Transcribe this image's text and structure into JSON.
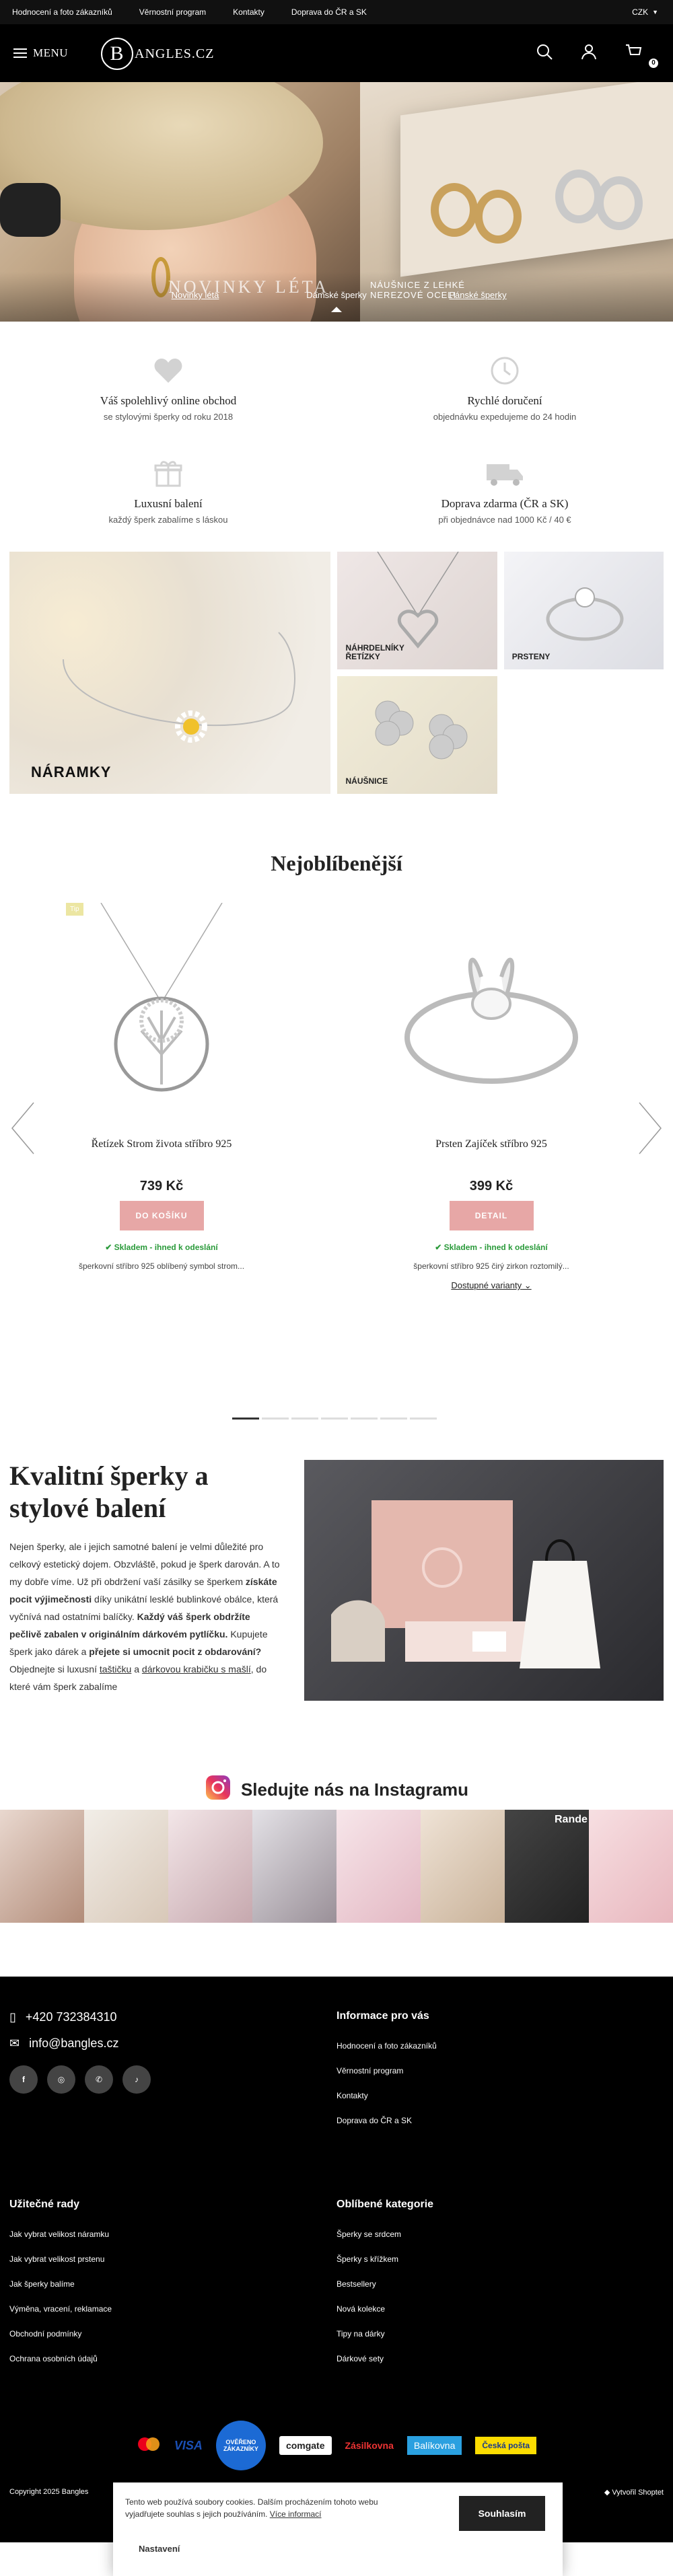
{
  "topbar": {
    "links": [
      "Hodnocení a foto zákazníků",
      "Věrnostní program",
      "Kontakty",
      "Doprava do ČR a SK"
    ],
    "currency": "CZK"
  },
  "header": {
    "menu_label": "MENU",
    "logo_letter": "B",
    "logo_text": "ANGLES.CZ",
    "cart_count": "0"
  },
  "hero": {
    "title": "NOVINKY LÉTA",
    "subtitle": "NÁUŠNICE Z LEHKÉ NEREZOVÉ OCELI",
    "tabs": [
      "Novinky léta",
      "Dámské šperky",
      "Pánské šperky"
    ]
  },
  "usp": [
    {
      "title": "Váš spolehlivý online obchod",
      "desc": "se stylovými šperky od roku 2018",
      "icon": "heart-icon"
    },
    {
      "title": "Rychlé doručení",
      "desc": "objednávku expedujeme do 24 hodin",
      "icon": "clock-icon"
    },
    {
      "title": "Luxusní balení",
      "desc": "každý šperk zabalíme s láskou",
      "icon": "gift-icon"
    },
    {
      "title": "Doprava zdarma (ČR a SK)",
      "desc": "při objednávce nad 1000 Kč / 40 €",
      "icon": "truck-icon"
    }
  ],
  "categories": [
    "NÁRAMKY",
    "NÁHRDELNÍKY ŘETÍZKY",
    "PRSTENY",
    "NÁUŠNICE"
  ],
  "popular": {
    "title": "Nejoblíbenější",
    "products": [
      {
        "badge": "Tip",
        "name": "Řetízek Strom života stříbro 925",
        "price": "739 Kč",
        "button": "DO KOŠÍKU",
        "stock": "Skladem - ihned k odeslání",
        "desc": "šperkovní stříbro 925 oblíbený symbol strom..."
      },
      {
        "name": "Prsten Zajíček stříbro 925",
        "price": "399 Kč",
        "button": "DETAIL",
        "stock": "Skladem - ihned k odeslání",
        "desc": "šperkovní stříbro 925 čirý zirkon roztomilý...",
        "variants": "Dostupné varianty"
      }
    ]
  },
  "packaging": {
    "title": "Kvalitní šperky a stylové balení",
    "p1": "Nejen šperky, ale i jejich samotné balení je velmi důležité pro celkový estetický dojem. Obzvláště, pokud je šperk darován. A to my dobře víme. Už při obdržení vaší zásilky se šperkem ",
    "b1": "získáte pocit výjimečnosti",
    "p2": " díky unikátní lesklé bublinkové obálce, která vyčnívá nad ostatními balíčky. ",
    "b2": "Každý váš šperk obdržíte pečlivě zabalen v originálním dárkovém pytlíčku.",
    "p3": " Kupujete šperk jako dárek a ",
    "b3": "přejete si umocnit pocit z obdarování?",
    "p4": " Objednejte si luxusní ",
    "l1": "taštičku",
    "p5": " a ",
    "l2": "dárkovou krabičku s mašlí",
    "p6": ", do které vám šperk zabalíme"
  },
  "instagram": {
    "title": "Sledujte nás na Instagramu",
    "tile_text_1": "Rande"
  },
  "footer": {
    "phone": "+420 732384310",
    "email": "info@bangles.cz",
    "info_title": "Informace pro vás",
    "info_links": [
      "Hodnocení a foto zákazníků",
      "Věrnostní program",
      "Kontakty",
      "Doprava do ČR a SK"
    ],
    "advice_title": "Užitečné rady",
    "advice_links": [
      "Jak vybrat velikost náramku",
      "Jak vybrat velikost prstenu",
      "Jak šperky balíme",
      "Výměna, vracení, reklamace",
      "Obchodní podmínky",
      "Ochrana osobních údajů"
    ],
    "cat_title": "Oblíbené kategorie",
    "cat_links": [
      "Šperky se srdcem",
      "Šperky s křížkem",
      "Bestsellery",
      "Nová kolekce",
      "Tipy na dárky",
      "Dárkové sety"
    ],
    "payments": [
      "VISA",
      "comgate",
      "Zásilkovna",
      "Balíkovna",
      "Česká pošta"
    ],
    "verified": "OVĚŘENO ZÁKAZNÍKY",
    "copyright": "Copyright 2025 Bangles",
    "powered": "Vytvořil Shoptet"
  },
  "cookie": {
    "text": "Tento web používá soubory cookies. Dalším procházením tohoto webu vyjadřujete souhlas s jejich používáním.",
    "more": "Více informací",
    "accept": "Souhlasím",
    "settings": "Nastavení"
  }
}
